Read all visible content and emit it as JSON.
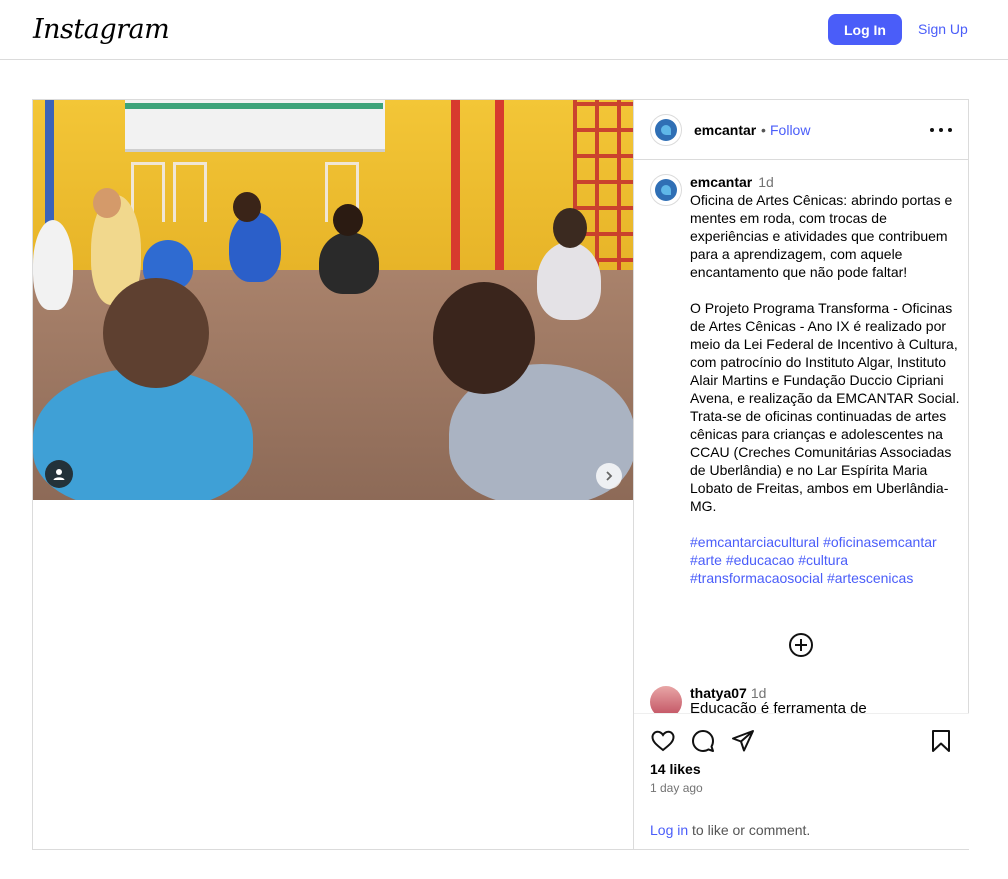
{
  "header": {
    "logo_text": "Instagram",
    "login_label": "Log In",
    "signup_label": "Sign Up"
  },
  "post": {
    "username": "emcantar",
    "dot": "•",
    "follow_label": "Follow",
    "caption_time": "1d",
    "caption_text": "Oficina de Artes Cênicas: abrindo portas e mentes em roda, com trocas de experiências e atividades que contribuem para a aprendizagem, com aquele encantamento que não pode faltar!\n\nO Projeto Programa Transforma - Oficinas de Artes Cênicas - Ano IX é realizado por meio da Lei Federal de Incentivo à Cultura, com patrocínio do Instituto Algar, Instituto Alair Martins e Fundação Duccio Cipriani Avena, e realização da EMCANTAR Social.\nTrata-se de oficinas continuadas de artes cênicas para crianças e adolescentes na CCAU (Creches Comunitárias Associadas de Uberlândia) e no Lar Espírita Maria Lobato de Freitas, ambos em Uberlândia-MG.",
    "hashtags": [
      "#emcantarciacultural",
      "#oficinasemcantar",
      "#arte",
      "#educacao",
      "#cultura",
      "#transformacaosocial",
      "#artescenicas"
    ],
    "comment": {
      "username": "thatya07",
      "time": "1d",
      "text": "Educação é ferramenta de"
    },
    "likes": "14 likes",
    "time_ago": "1 day ago",
    "login_link": "Log in",
    "login_suffix": " to like or comment."
  }
}
